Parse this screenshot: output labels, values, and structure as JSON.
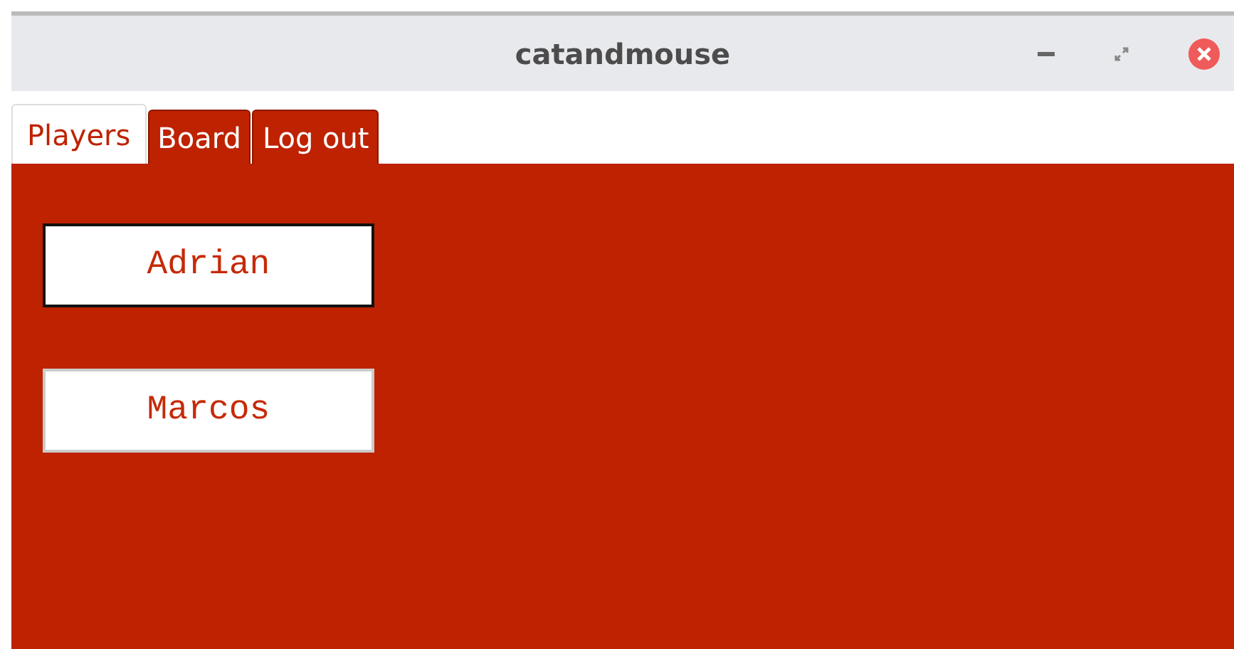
{
  "window": {
    "title": "catandmouse"
  },
  "tabs": [
    {
      "label": "Players",
      "selected": true
    },
    {
      "label": "Board",
      "selected": false
    },
    {
      "label": "Log out",
      "selected": false
    }
  ],
  "players": [
    {
      "label": "Adrian",
      "focused": true
    },
    {
      "label": "Marcos",
      "focused": false
    }
  ]
}
